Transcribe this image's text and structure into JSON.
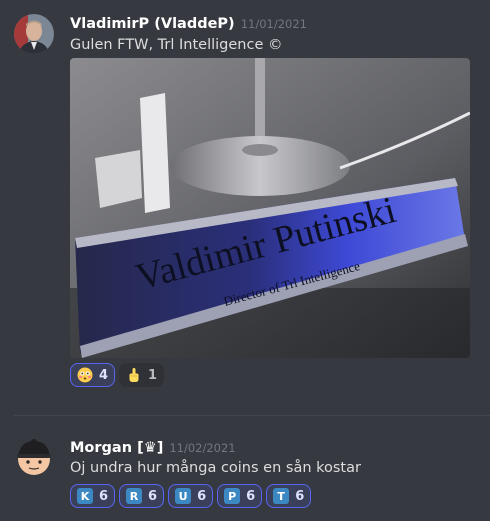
{
  "messages": [
    {
      "author": "VladimirP (VladdeP)",
      "timestamp": "11/01/2021",
      "text": "Gulen FTW, Trl Intelligence ©",
      "attachment": {
        "nameplate_name": "Valdimir Putinski",
        "nameplate_title": "Director of Trl Intelligence"
      },
      "reactions": [
        {
          "icon": "flushed-face-emoji",
          "count": "4",
          "me": true
        },
        {
          "icon": "middle-finger-emoji",
          "count": "1",
          "me": false
        }
      ]
    },
    {
      "author": "Morgan [♛]",
      "timestamp": "11/02/2021",
      "text": "Oj undra hur många coins en sån kostar",
      "reactions": [
        {
          "icon": "regional-indicator-k",
          "letter": "K",
          "count": "6",
          "me": true
        },
        {
          "icon": "regional-indicator-r",
          "letter": "R",
          "count": "6",
          "me": true
        },
        {
          "icon": "regional-indicator-u",
          "letter": "U",
          "count": "6",
          "me": true
        },
        {
          "icon": "regional-indicator-p",
          "letter": "P",
          "count": "6",
          "me": true
        },
        {
          "icon": "regional-indicator-t",
          "letter": "T",
          "count": "6",
          "me": true
        }
      ]
    }
  ],
  "colors": {
    "background": "#36393f",
    "reaction_active": "#5865f2",
    "regional_indicator": "#3b88c3"
  }
}
